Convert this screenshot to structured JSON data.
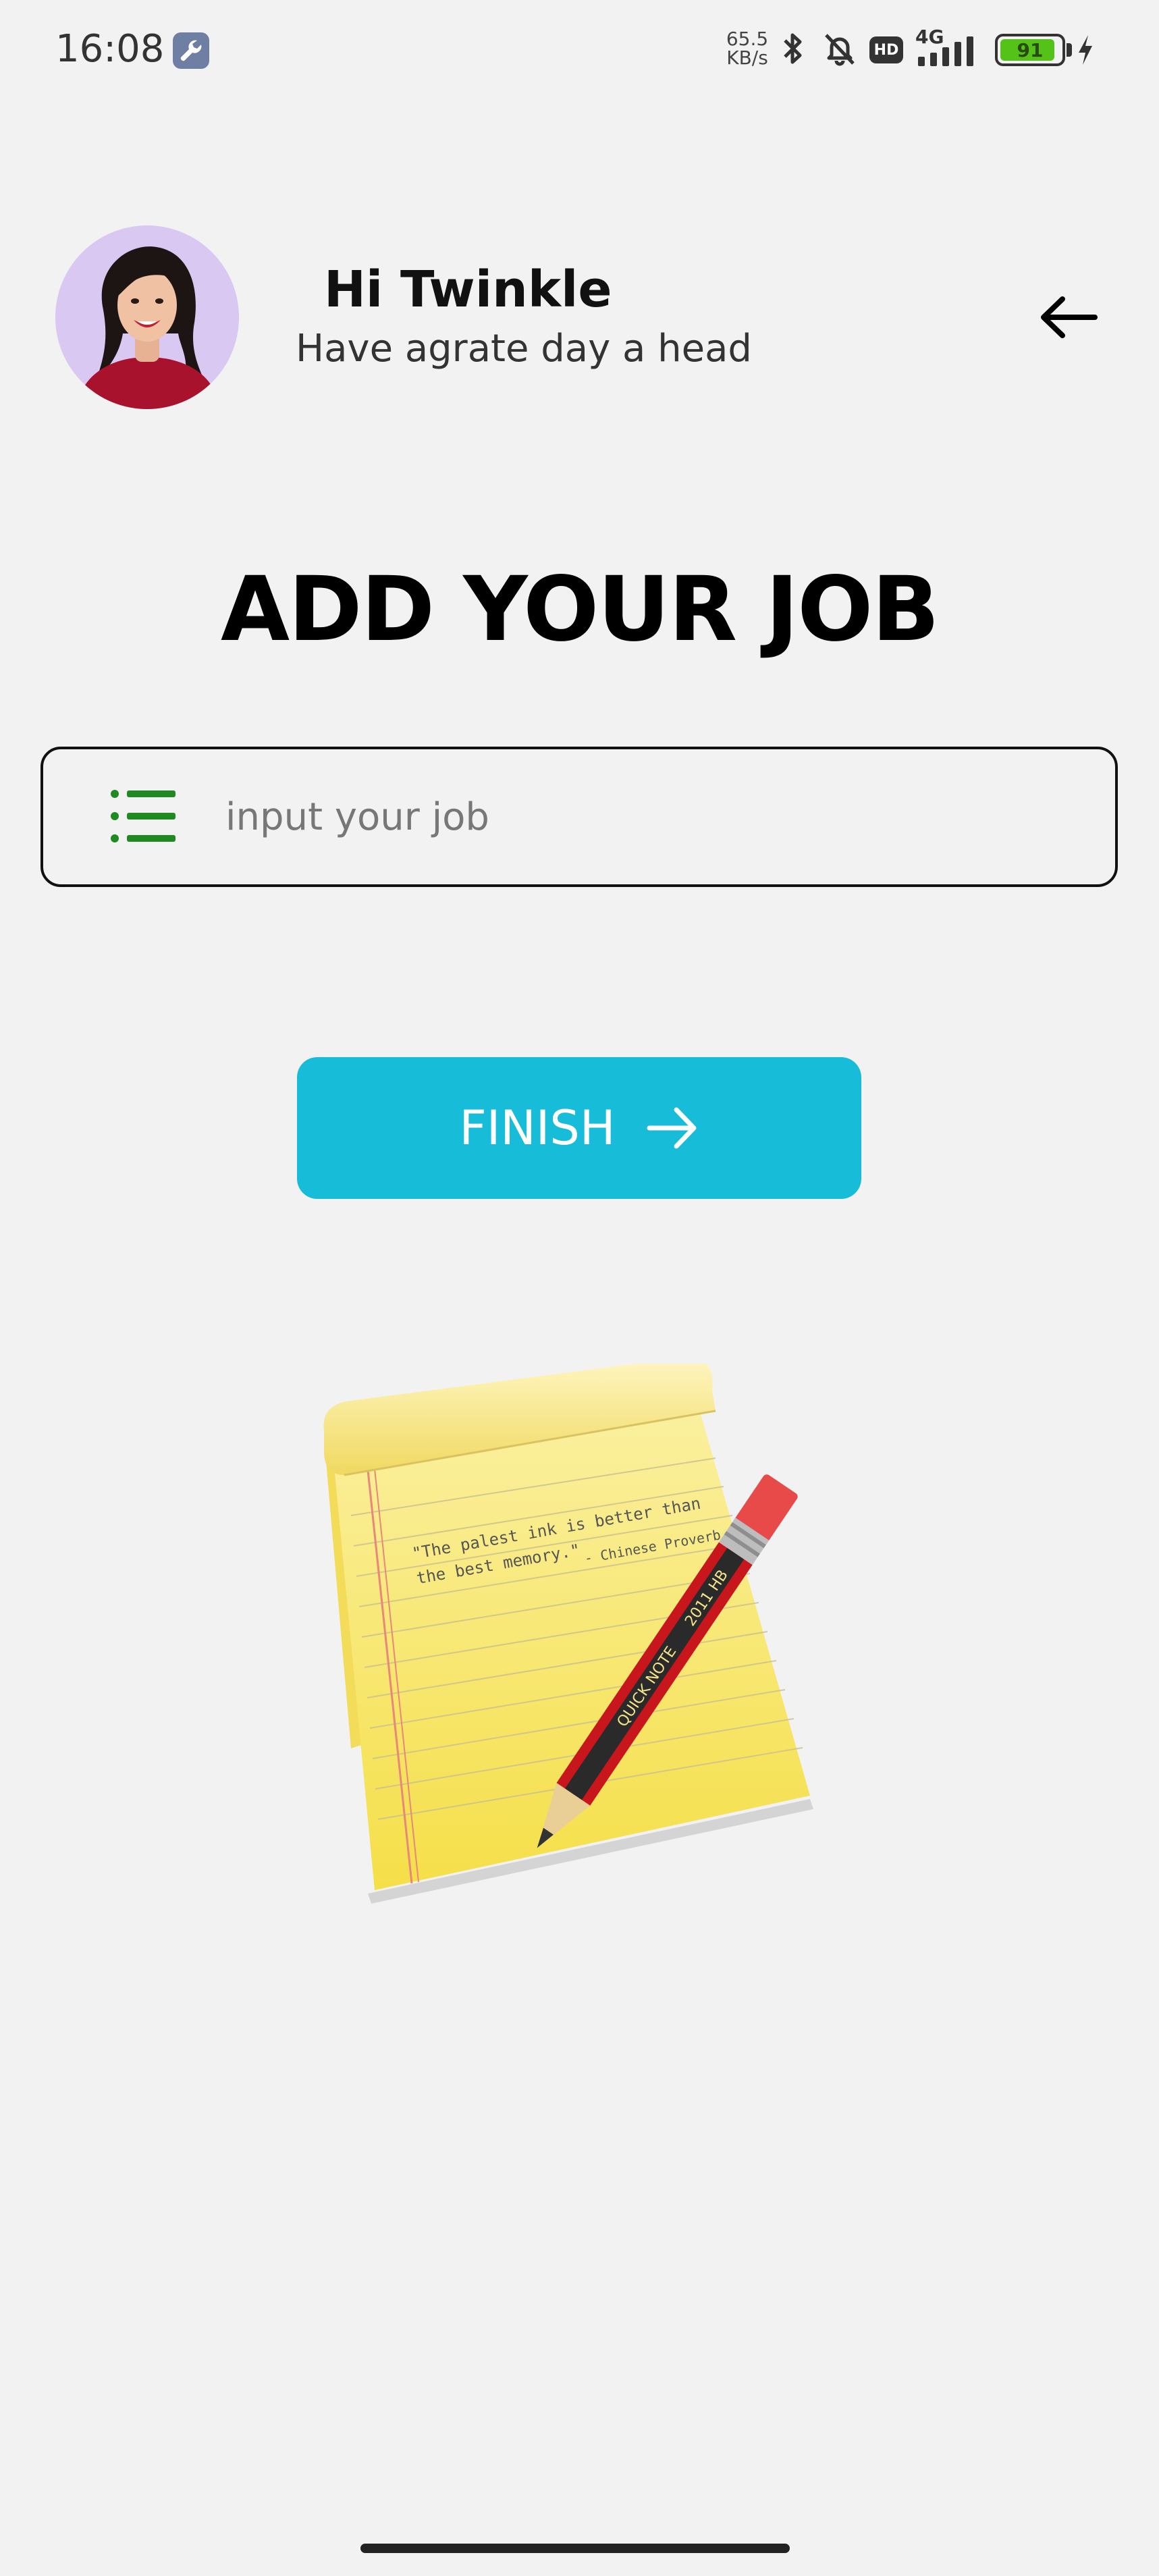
{
  "status_bar": {
    "time": "16:08",
    "net_speed_value": "65.5",
    "net_speed_unit": "KB/s",
    "hd_label": "HD",
    "network_label": "4G",
    "battery_level": "91",
    "battery_percent": 91
  },
  "header": {
    "greeting": "Hi Twinkle",
    "subtitle": "Have agrate day a head"
  },
  "main": {
    "title": "ADD YOUR JOB",
    "job_input": {
      "placeholder": "input your job",
      "value": ""
    },
    "finish_button_label": "FINISH"
  },
  "illustration": {
    "quote_line1": "\"The palest ink is better than",
    "quote_line2": "the best memory.\"",
    "quote_author": "- Chinese Proverb",
    "pencil_text_1": "QUICK NOTE",
    "pencil_text_2": "2011 HB"
  },
  "colors": {
    "accent": "#17bcd8",
    "list_icon": "#1f8a1f",
    "background": "#f2f2f2"
  }
}
